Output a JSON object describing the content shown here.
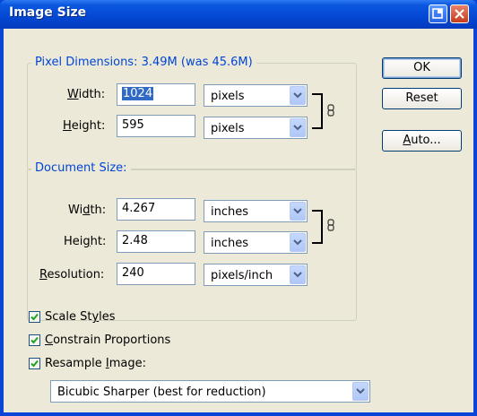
{
  "window": {
    "title": "Image Size"
  },
  "pixel_dimensions": {
    "label": "Pixel Dimensions:",
    "size_text": "3.49M (was 45.6M)",
    "width": {
      "label_pre": "",
      "label_ul": "W",
      "label_post": "idth:",
      "value": "1024",
      "unit": "pixels"
    },
    "height": {
      "label_pre": "",
      "label_ul": "H",
      "label_post": "eight:",
      "value": "595",
      "unit": "pixels"
    }
  },
  "document_size": {
    "label": "Document Size:",
    "width": {
      "label_pre": "Wi",
      "label_ul": "d",
      "label_post": "th:",
      "value": "4.267",
      "unit": "inches"
    },
    "height": {
      "label_pre": "Hei",
      "label_ul": "g",
      "label_post": "ht:",
      "value": "2.48",
      "unit": "inches"
    },
    "resolution": {
      "label_pre": "",
      "label_ul": "R",
      "label_post": "esolution:",
      "value": "240",
      "unit": "pixels/inch"
    }
  },
  "buttons": {
    "ok": "OK",
    "reset": "Reset",
    "auto_ul": "A",
    "auto_post": "uto..."
  },
  "checkboxes": {
    "scale_styles": {
      "pre": "Scale St",
      "ul": "y",
      "post": "les",
      "checked": true
    },
    "constrain": {
      "pre": "",
      "ul": "C",
      "post": "onstrain Proportions",
      "checked": true
    },
    "resample": {
      "pre": "Resample ",
      "ul": "I",
      "post": "mage:",
      "checked": true
    }
  },
  "resample_method": "Bicubic Sharper (best for reduction)",
  "colors": {
    "accent": "#0046d5",
    "titlebar": "#0a57e0",
    "dialog_bg": "#ece9d8"
  }
}
